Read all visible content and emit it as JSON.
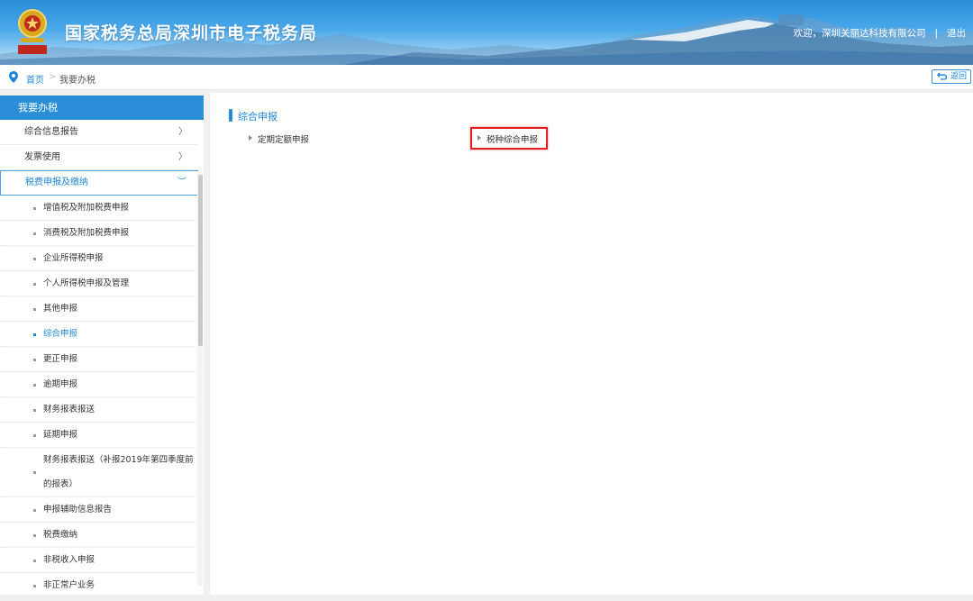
{
  "header": {
    "title": "国家税务总局深圳市电子税务局",
    "welcome": "欢迎，深圳关丽达科技有限公司",
    "separator": "|",
    "logout": "退出",
    "emblem_text": "中国税务"
  },
  "breadcrumb": {
    "home": "首页",
    "separator": ">",
    "current": "我要办税",
    "back": "返回"
  },
  "sidebar": {
    "heading": "我要办税",
    "items": [
      {
        "label": "综合信息报告",
        "arrow": "〉"
      },
      {
        "label": "发票使用",
        "arrow": "〉"
      },
      {
        "label": "税费申报及缴纳",
        "arrow": "︶"
      }
    ],
    "sub_items": [
      {
        "label": "增值税及附加税费申报"
      },
      {
        "label": "消费税及附加税费申报"
      },
      {
        "label": "企业所得税申报"
      },
      {
        "label": "个人所得税申报及管理"
      },
      {
        "label": "其他申报"
      },
      {
        "label": "综合申报"
      },
      {
        "label": "更正申报"
      },
      {
        "label": "逾期申报"
      },
      {
        "label": "财务报表报送"
      },
      {
        "label": "延期申报"
      },
      {
        "label": "财务报表报送（补报2019年第四季度前的报表）"
      },
      {
        "label": "申报辅助信息报告"
      },
      {
        "label": "税费缴纳"
      },
      {
        "label": "非税收入申报"
      },
      {
        "label": "非正常户业务"
      }
    ]
  },
  "main": {
    "section_title": "综合申报",
    "links": [
      {
        "label": "定期定额申报"
      },
      {
        "label": "税种综合申报"
      }
    ]
  },
  "colors": {
    "accent": "#2a8fd8",
    "link": "#1e86d8",
    "highlight_box": "#e02020"
  }
}
